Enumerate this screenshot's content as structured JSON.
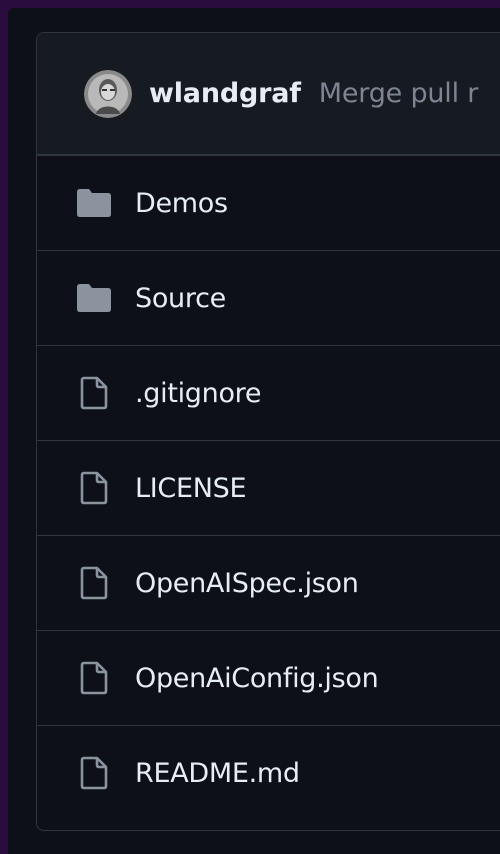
{
  "colors": {
    "page_bg": "#2a0c3e",
    "panel_bg": "#0d1117",
    "header_bg": "#161b22",
    "border": "#30363d",
    "text_primary": "#e6edf3",
    "text_muted": "#7d8590",
    "icon": "#8b949e"
  },
  "commit": {
    "author": "wlandgraf",
    "message": "Merge pull r"
  },
  "files": [
    {
      "name": "Demos",
      "type": "folder",
      "icon": "folder-icon"
    },
    {
      "name": "Source",
      "type": "folder",
      "icon": "folder-icon"
    },
    {
      "name": ".gitignore",
      "type": "file",
      "icon": "file-icon"
    },
    {
      "name": "LICENSE",
      "type": "file",
      "icon": "file-icon"
    },
    {
      "name": "OpenAISpec.json",
      "type": "file",
      "icon": "file-icon"
    },
    {
      "name": "OpenAiConfig.json",
      "type": "file",
      "icon": "file-icon"
    },
    {
      "name": "README.md",
      "type": "file",
      "icon": "file-icon"
    }
  ]
}
